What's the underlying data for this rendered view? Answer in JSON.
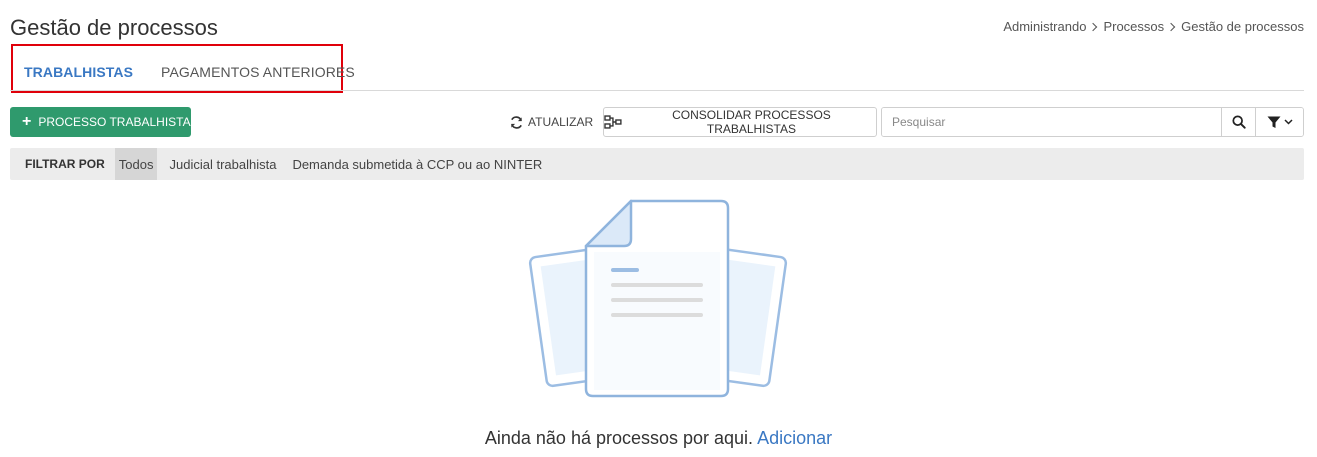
{
  "page": {
    "title": "Gestão de processos"
  },
  "breadcrumb": [
    "Administrando",
    "Processos",
    "Gestão de processos"
  ],
  "tabs": [
    {
      "label": "TRABALHISTAS",
      "active": true
    },
    {
      "label": "PAGAMENTOS ANTERIORES",
      "active": false
    }
  ],
  "toolbar": {
    "add_label": "PROCESSO TRABALHISTA",
    "refresh_label": "ATUALIZAR",
    "consolidate_label": "CONSOLIDAR PROCESSOS TRABALHISTAS",
    "search_placeholder": "Pesquisar"
  },
  "filters": {
    "label": "FILTRAR POR",
    "options": [
      {
        "label": "Todos",
        "active": true
      },
      {
        "label": "Judicial trabalhista",
        "active": false
      },
      {
        "label": "Demanda submetida à CCP ou ao NINTER",
        "active": false
      }
    ]
  },
  "empty_state": {
    "message": "Ainda não há processos por aqui.",
    "link_label": "Adicionar",
    "illustration": "empty-documents-icon"
  },
  "colors": {
    "primary": "#2f9a6d",
    "link": "#3a78c3",
    "highlight": "#e0000a",
    "illustration_stroke": "#8fb4dd"
  }
}
